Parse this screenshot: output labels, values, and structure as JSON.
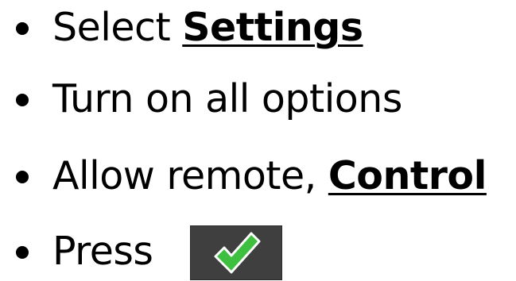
{
  "bullets": [
    {
      "text": "Select ",
      "emphasis": "Settings"
    },
    {
      "text": "Turn on all options"
    },
    {
      "text": "Allow remote, ",
      "emphasis": "Control"
    },
    {
      "text": "Press"
    }
  ],
  "confirm_button": {
    "icon": "checkmark-icon",
    "background": "#3f3f3f",
    "check_fill": "#3fbf3f",
    "check_outline": "#ffffff"
  }
}
